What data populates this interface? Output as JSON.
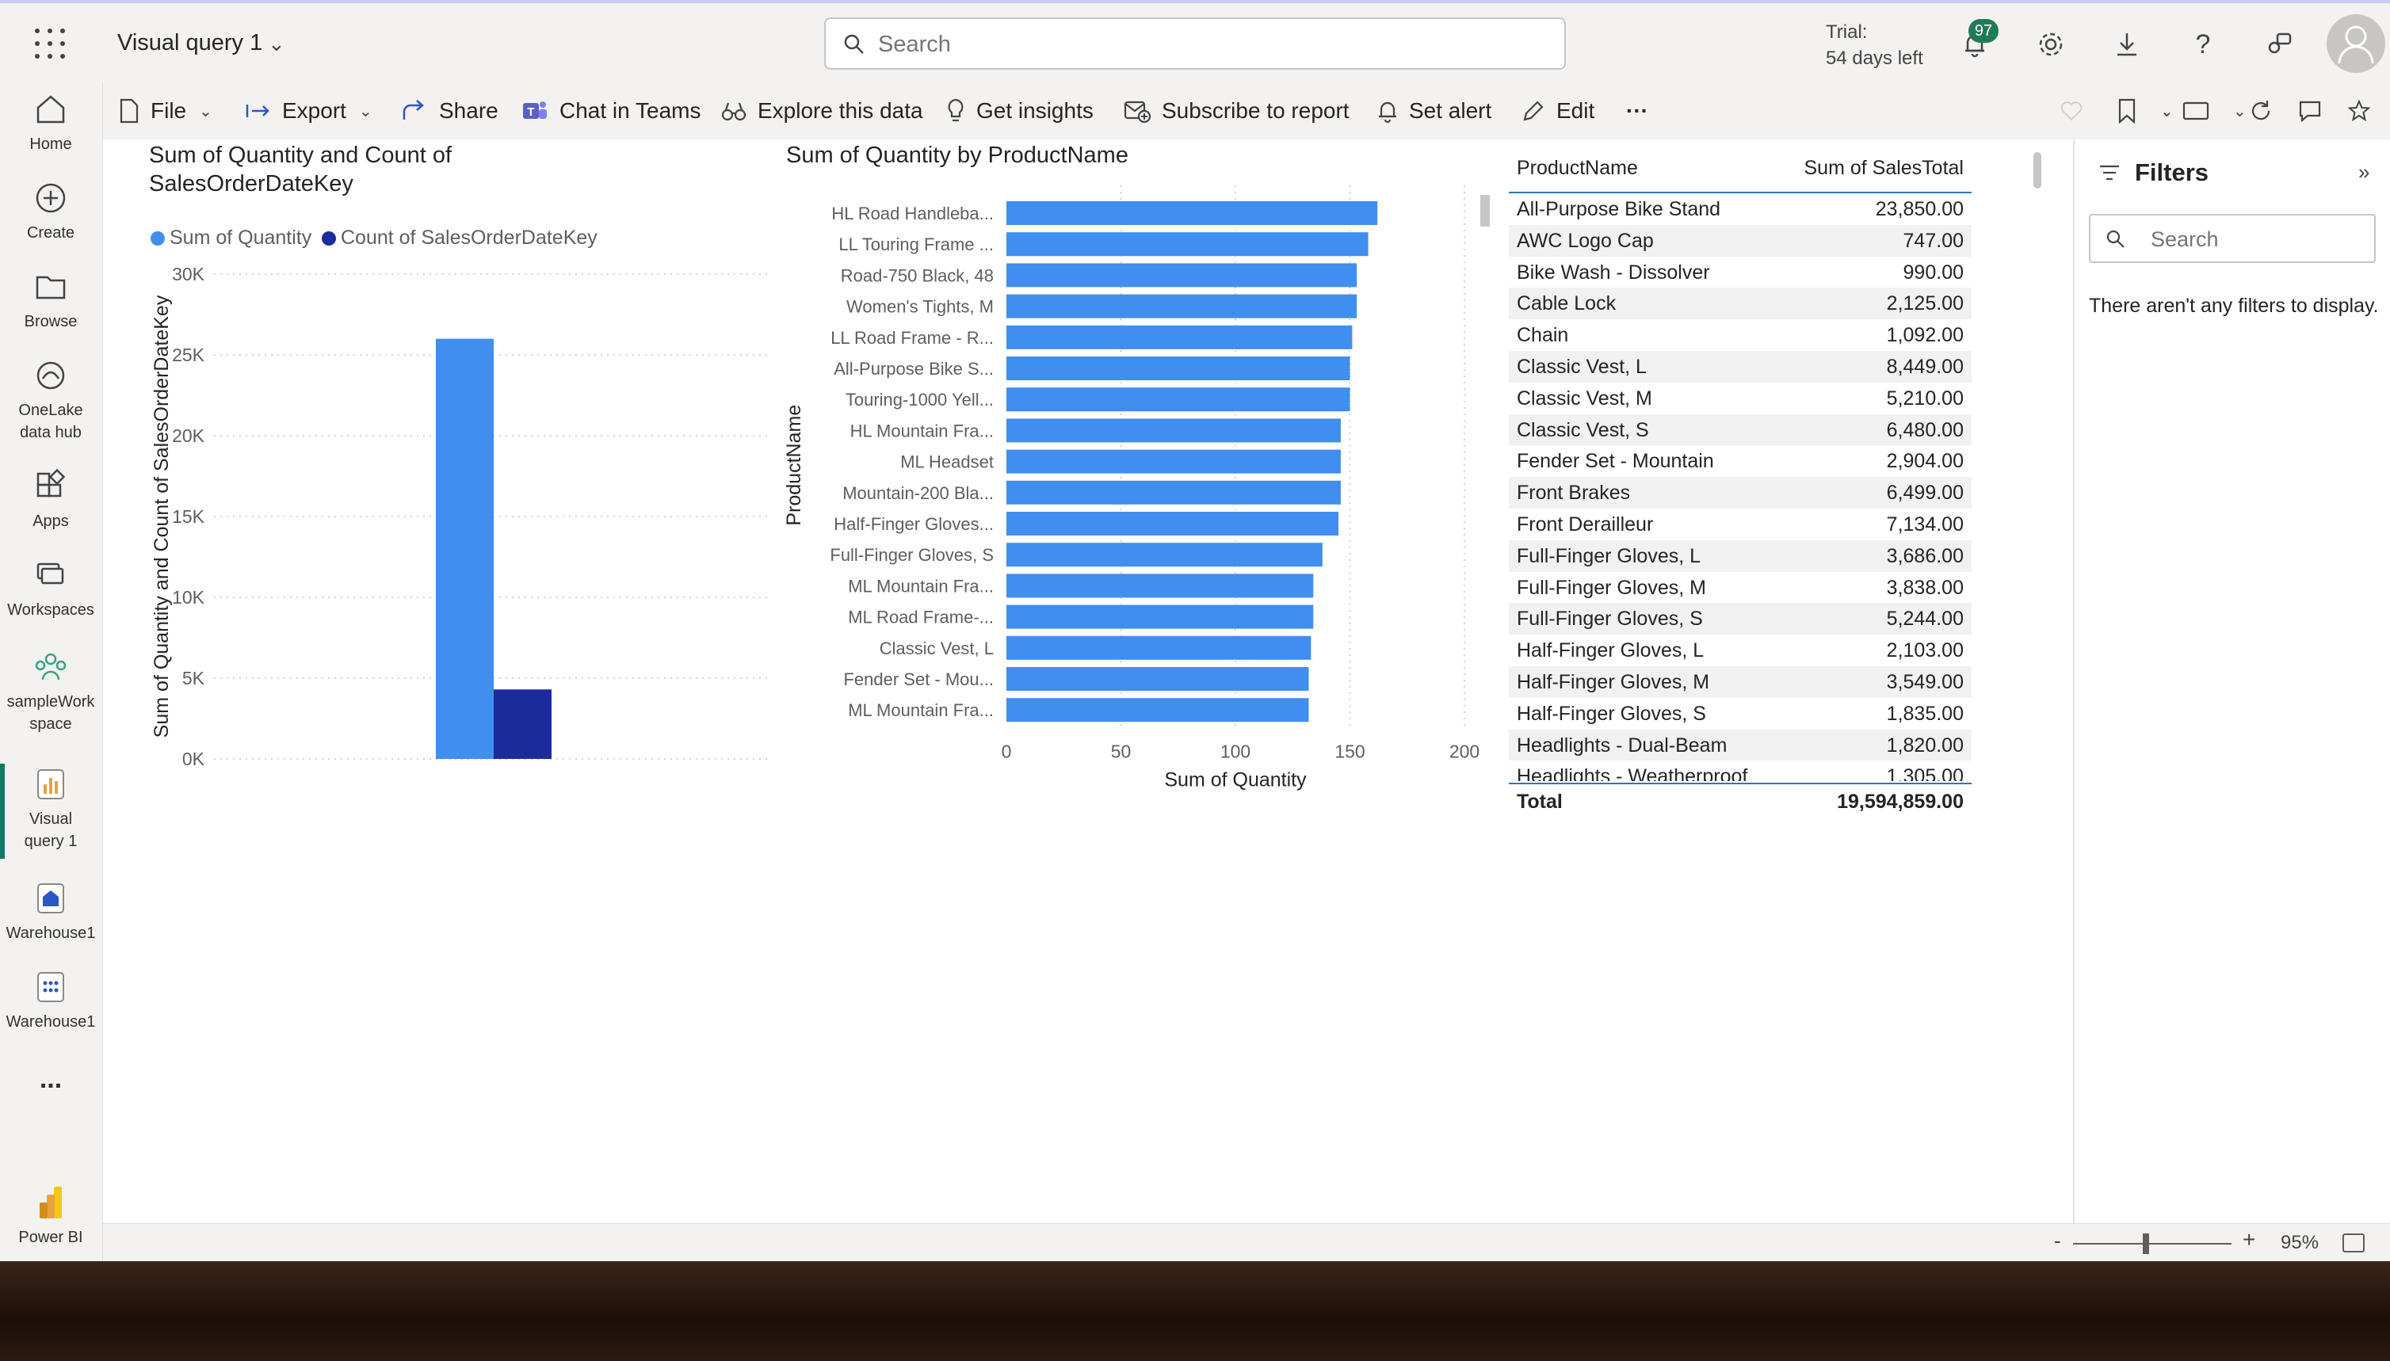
{
  "header": {
    "title": "Visual query 1",
    "search_placeholder": "Search",
    "trial_line1": "Trial:",
    "trial_line2": "54 days left",
    "notification_count": "97"
  },
  "nav": {
    "items": [
      {
        "label": "Home",
        "icon": "home-icon"
      },
      {
        "label": "Create",
        "icon": "plus-circle-icon"
      },
      {
        "label": "Browse",
        "icon": "folder-icon"
      },
      {
        "label": "OneLake",
        "label2": "data hub",
        "icon": "onelake-icon"
      },
      {
        "label": "Apps",
        "icon": "apps-icon"
      },
      {
        "label": "Workspaces",
        "icon": "workspaces-icon"
      },
      {
        "label": "sampleWork",
        "label2": "space",
        "icon": "people-icon"
      },
      {
        "label": "Visual",
        "label2": "query 1",
        "icon": "report-icon"
      },
      {
        "label": "Warehouse1",
        "icon": "warehouse-icon"
      },
      {
        "label": "Warehouse1",
        "icon": "warehouse-dots-icon"
      }
    ],
    "more": "...",
    "brand": "Power BI"
  },
  "toolbar": {
    "file": "File",
    "export": "Export",
    "share": "Share",
    "chat": "Chat in Teams",
    "explore": "Explore this data",
    "insights": "Get insights",
    "subscribe": "Subscribe to report",
    "alert": "Set alert",
    "edit": "Edit",
    "more": "···"
  },
  "filters": {
    "title": "Filters",
    "search_placeholder": "Search",
    "empty": "There aren't any filters to display."
  },
  "status": {
    "zoom": "95%",
    "minus": "-",
    "plus": "+"
  },
  "colors": {
    "primary": "#3f8ef0",
    "secondary": "#1c2b9c",
    "accent": "#117865"
  },
  "chart_data": [
    {
      "type": "bar",
      "title_line1": "Sum of Quantity and Count of",
      "title_line2": "SalesOrderDateKey",
      "ylabel": "Sum of Quantity and Count of SalesOrderDateKey",
      "yticks": [
        "0K",
        "5K",
        "10K",
        "15K",
        "20K",
        "25K",
        "30K"
      ],
      "ylim": [
        0,
        30000
      ],
      "legend": "top-left",
      "series": [
        {
          "name": "Sum of Quantity",
          "values": [
            26000
          ],
          "color": "#3f8ef0"
        },
        {
          "name": "Count of SalesOrderDateKey",
          "values": [
            4300
          ],
          "color": "#1c2b9c"
        }
      ]
    },
    {
      "type": "bar",
      "orientation": "horizontal",
      "title": "Sum of Quantity by ProductName",
      "xlabel": "Sum of Quantity",
      "ylabel": "ProductName",
      "xticks": [
        "0",
        "50",
        "100",
        "150",
        "200"
      ],
      "xlim": [
        0,
        200
      ],
      "categories": [
        "HL Road Handleba...",
        "LL Touring Frame ...",
        "Road-750 Black, 48",
        "Women's Tights, M",
        "LL Road Frame - R...",
        "All-Purpose Bike S...",
        "Touring-1000 Yell...",
        "HL Mountain Fra...",
        "ML Headset",
        "Mountain-200 Bla...",
        "Half-Finger Gloves...",
        "Full-Finger Gloves, S",
        "ML Mountain Fra...",
        "ML Road Frame-...",
        "Classic Vest, L",
        "Fender Set - Mou...",
        "ML Mountain Fra..."
      ],
      "values": [
        162,
        158,
        153,
        153,
        151,
        150,
        150,
        146,
        146,
        146,
        145,
        138,
        134,
        134,
        133,
        132,
        132
      ]
    },
    {
      "type": "table",
      "columns": [
        "ProductName",
        "Sum of SalesTotal"
      ],
      "rows": [
        [
          "All-Purpose Bike Stand",
          "23,850.00"
        ],
        [
          "AWC Logo Cap",
          "747.00"
        ],
        [
          "Bike Wash - Dissolver",
          "990.00"
        ],
        [
          "Cable Lock",
          "2,125.00"
        ],
        [
          "Chain",
          "1,092.00"
        ],
        [
          "Classic Vest, L",
          "8,449.00"
        ],
        [
          "Classic Vest, M",
          "5,210.00"
        ],
        [
          "Classic Vest, S",
          "6,480.00"
        ],
        [
          "Fender Set - Mountain",
          "2,904.00"
        ],
        [
          "Front Brakes",
          "6,499.00"
        ],
        [
          "Front Derailleur",
          "7,134.00"
        ],
        [
          "Full-Finger Gloves, L",
          "3,686.00"
        ],
        [
          "Full-Finger Gloves, M",
          "3,838.00"
        ],
        [
          "Full-Finger Gloves, S",
          "5,244.00"
        ],
        [
          "Half-Finger Gloves, L",
          "2,103.00"
        ],
        [
          "Half-Finger Gloves, M",
          "3,549.00"
        ],
        [
          "Half-Finger Gloves, S",
          "1,835.00"
        ],
        [
          "Headlights - Dual-Beam",
          "1,820.00"
        ],
        [
          "Headlights - Weatherproof",
          "1,305.00"
        ]
      ],
      "total_label": "Total",
      "total_value": "19,594,859.00"
    }
  ]
}
